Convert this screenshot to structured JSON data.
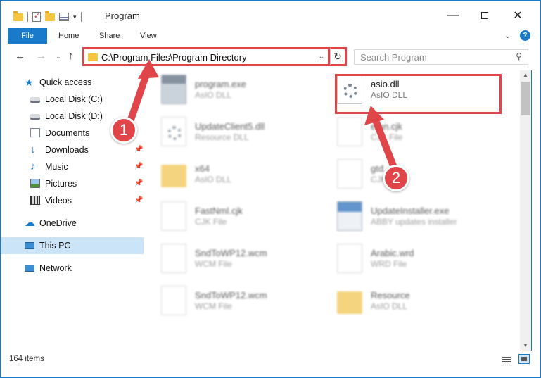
{
  "window": {
    "title": "Program",
    "controls": {
      "minimize": "—",
      "maximize": "",
      "close": "✕"
    }
  },
  "ribbon": {
    "tabs": [
      {
        "label": "File"
      },
      {
        "label": "Home"
      },
      {
        "label": "Share"
      },
      {
        "label": "View"
      }
    ],
    "help": "?"
  },
  "address": {
    "path": "C:\\Program Files\\Program Directory",
    "search_placeholder": "Search Program"
  },
  "nav": {
    "back": "←",
    "forward": "→",
    "up": "↑",
    "refresh": "↻",
    "search_icon": "⚲",
    "items": [
      {
        "label": "Quick access",
        "icon": "star-icon"
      },
      {
        "label": "Local Disk (C:)",
        "icon": "disk-icon"
      },
      {
        "label": "Local Disk (D:)",
        "icon": "disk-icon"
      },
      {
        "label": "Documents",
        "icon": "documents-icon"
      },
      {
        "label": "Downloads",
        "icon": "downloads-icon"
      },
      {
        "label": "Music",
        "icon": "music-icon"
      },
      {
        "label": "Pictures",
        "icon": "pictures-icon"
      },
      {
        "label": "Videos",
        "icon": "videos-icon"
      },
      {
        "label": "OneDrive",
        "icon": "cloud-icon"
      },
      {
        "label": "This PC",
        "icon": "computer-icon",
        "selected": true
      },
      {
        "label": "Network",
        "icon": "network-icon"
      }
    ]
  },
  "files": [
    {
      "name": "program.exe",
      "type": "AsIO DLL",
      "icon": "exe-icon"
    },
    {
      "name": "asio.dll",
      "type": "AsIO DLL",
      "icon": "dll-gear-icon",
      "highlighted": true
    },
    {
      "name": "UpdateClient5.dll",
      "type": "Resource DLL",
      "icon": "dll-icon"
    },
    {
      "name": "etan.cjk",
      "type": "CJK File",
      "icon": "file-icon"
    },
    {
      "name": "x64",
      "type": "AsIO DLL",
      "icon": "folder-icon"
    },
    {
      "name": "gtd",
      "type": "CJK File",
      "icon": "file-icon"
    },
    {
      "name": "FastNml.cjk",
      "type": "CJK File",
      "icon": "file-icon"
    },
    {
      "name": "UpdateInstaller.exe",
      "type": "ABBY updates installer",
      "icon": "installer-icon"
    },
    {
      "name": "SndToWP12.wcm",
      "type": "WCM File",
      "icon": "file-icon"
    },
    {
      "name": "Arabic.wrd",
      "type": "WRD File",
      "icon": "file-icon"
    },
    {
      "name": "SndToWP12.wcm",
      "type": "WCM File",
      "icon": "file-icon"
    },
    {
      "name": "Resource",
      "type": "AsIO DLL",
      "icon": "folder-icon"
    }
  ],
  "status": {
    "item_count": "164 items"
  },
  "annotations": {
    "step1": "1",
    "step2": "2",
    "accent": "#e0454a"
  }
}
